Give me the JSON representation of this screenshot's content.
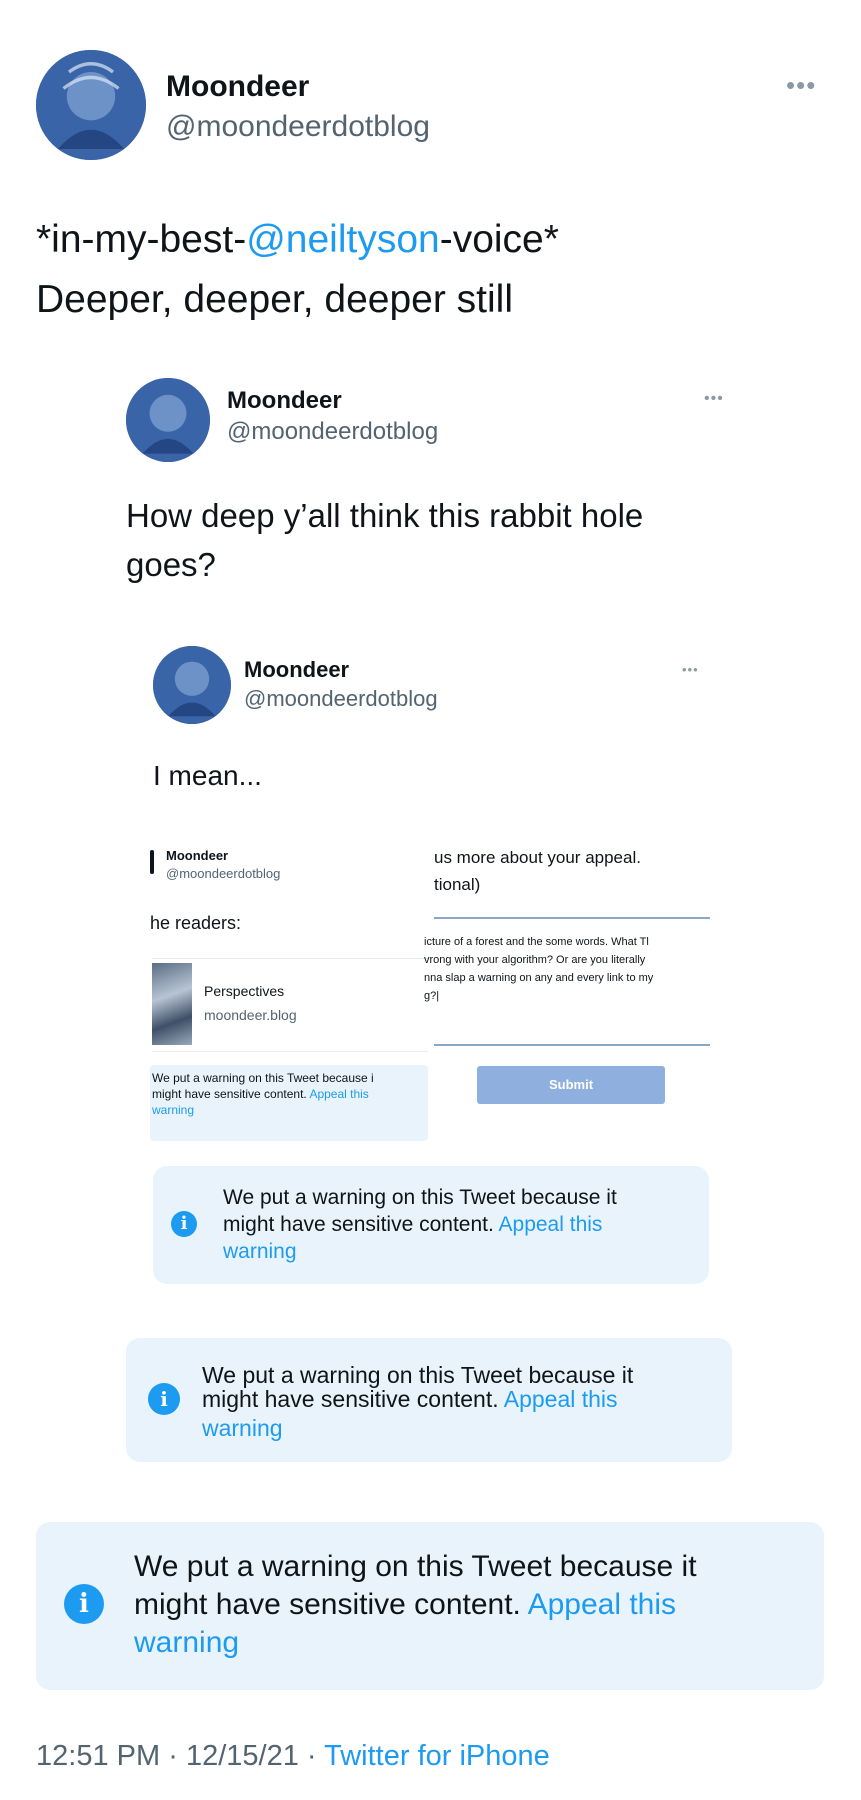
{
  "tweet": {
    "author_name": "Moondeer",
    "author_handle": "@moondeerdotblog",
    "more_icon": "more-horizontal-icon",
    "text_prefix": "*in-my-best-",
    "mention": "@neiltyson",
    "text_suffix": "-voice*",
    "text_line2": "Deeper, deeper, deeper still",
    "timestamp_time": "12:51 PM",
    "separator": "·",
    "timestamp_date": "12/15/21",
    "client": "Twitter for iPhone"
  },
  "quote1": {
    "author_name": "Moondeer",
    "author_handle": "@moondeerdotblog",
    "text_line1": "How deep y’all think this rabbit hole",
    "text_line2": "goes?"
  },
  "quote2": {
    "author_name": "Moondeer",
    "author_handle": "@moondeerdotblog",
    "text": "I mean..."
  },
  "screenshot": {
    "author_name": "Moondeer",
    "author_handle": "@moondeerdotblog",
    "readers_text": "he readers:",
    "link_title": "Perspectives",
    "link_domain": "moondeer.blog",
    "warning_line1": "We put a warning on this Tweet because i",
    "warning_line2_text": "might have sensitive content.",
    "warning_line2_link": "Appeal this",
    "warning_line3_link": "warning",
    "appeal_heading": "us more about your appeal.",
    "appeal_optional": "tional)",
    "appeal_text_line1": "icture of a forest and the some words. What Tl",
    "appeal_text_line2": "vrong with your algorithm? Or are you literally",
    "appeal_text_line3": "nna slap a warning on any and every link to my",
    "appeal_text_line4": "g?|",
    "submit_label": "Submit"
  },
  "warnings": {
    "line1": "We put a warning on this Tweet because it",
    "line2_text": "might have sensitive content.",
    "line2_link": "Appeal this",
    "line3_link": "warning",
    "icon": "info-icon",
    "icon_glyph": "i"
  },
  "colors": {
    "link": "#1d9bf0",
    "warning_bg": "#e8f3fb",
    "submit_bg": "#8fb0de",
    "avatar": "#3a64a8"
  }
}
